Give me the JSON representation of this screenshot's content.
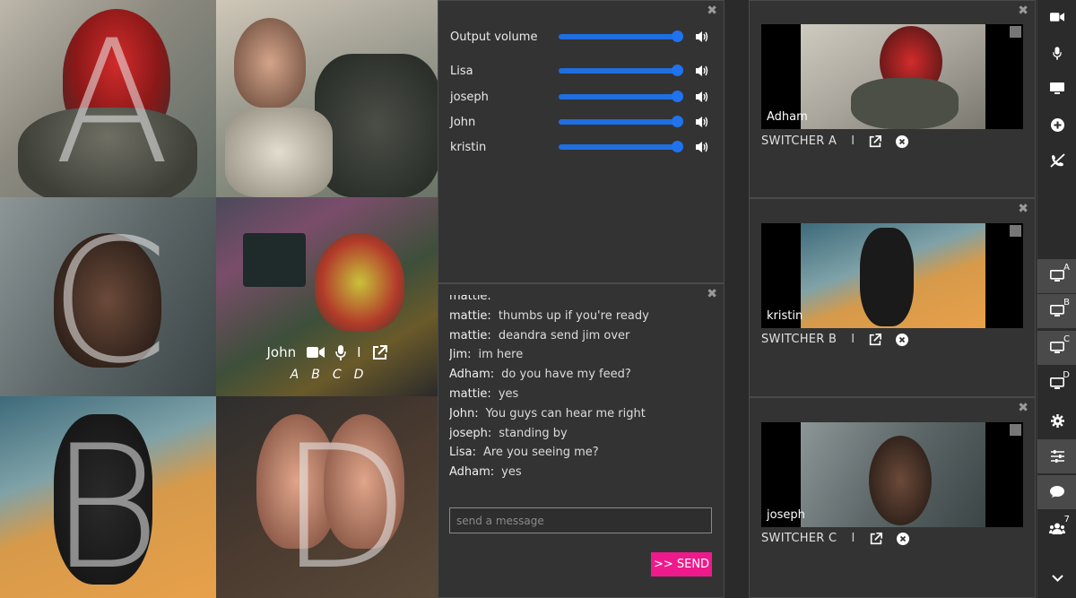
{
  "grid": {
    "tiles": [
      {
        "letter": "A"
      },
      {
        "letter": ""
      },
      {
        "letter": "C"
      },
      {
        "letter": ""
      },
      {
        "letter": "B"
      },
      {
        "letter": "D"
      }
    ],
    "overlay": {
      "name": "John",
      "sep": "I",
      "letters": [
        "A",
        "B",
        "C",
        "D"
      ]
    }
  },
  "volume": {
    "master_label": "Output volume",
    "master_level": 1.0,
    "participants": [
      {
        "name": "Lisa",
        "level": 1.0
      },
      {
        "name": "joseph",
        "level": 1.0
      },
      {
        "name": "John",
        "level": 1.0
      },
      {
        "name": "kristin",
        "level": 1.0
      }
    ]
  },
  "chat": {
    "messages": [
      {
        "who": "mattie:",
        "text": ""
      },
      {
        "who": "mattie:",
        "text": "thumbs up if you're ready"
      },
      {
        "who": "mattie:",
        "text": "deandra send jim over"
      },
      {
        "who": "Jim:",
        "text": "im here"
      },
      {
        "who": "Adham:",
        "text": "do you have my feed?"
      },
      {
        "who": "mattie:",
        "text": "yes"
      },
      {
        "who": "John:",
        "text": "You guys can hear me right"
      },
      {
        "who": "joseph:",
        "text": "standing by"
      },
      {
        "who": "Lisa:",
        "text": "Are you seeing me?"
      },
      {
        "who": "Adham:",
        "text": "yes"
      }
    ],
    "placeholder": "send a message",
    "send_label": ">> SEND"
  },
  "switchers": [
    {
      "label": "SWITCHER A",
      "sep": "I",
      "name": "Adham"
    },
    {
      "label": "SWITCHER B",
      "sep": "I",
      "name": "kristin"
    },
    {
      "label": "SWITCHER C",
      "sep": "I",
      "name": "joseph"
    }
  ],
  "toolbar": {
    "badges": {
      "switch_a": "A",
      "switch_b": "B",
      "switch_c": "C",
      "switch_d": "D",
      "participants": "7"
    }
  },
  "colors": {
    "accent": "#1f73ee",
    "send": "#ee1a8c",
    "panel": "#333333"
  }
}
